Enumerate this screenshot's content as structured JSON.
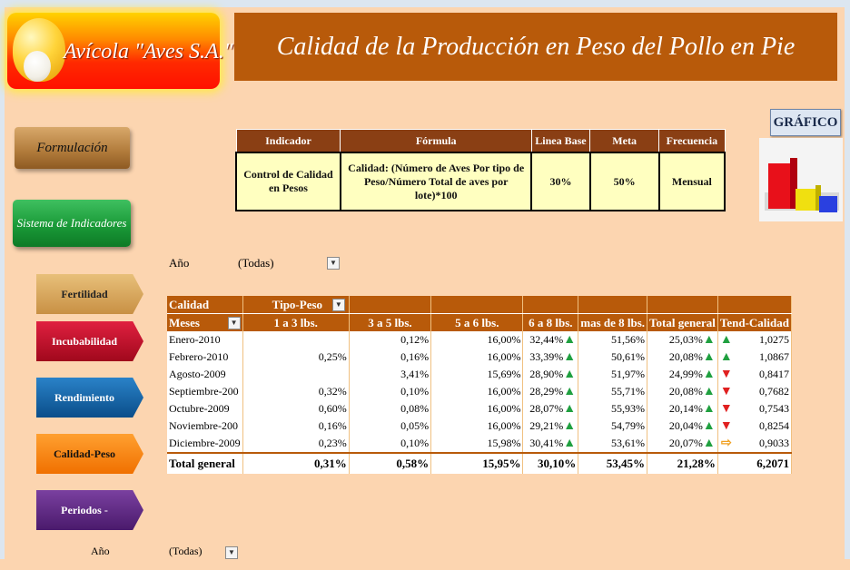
{
  "logo": {
    "text": "Avícola \"Aves S.A.\""
  },
  "header": {
    "title": "Calidad de la Producción en Peso del Pollo en Pie"
  },
  "nav": {
    "formulacion": "Formulación",
    "sistema": "Sistema de Indicadores",
    "items": [
      "Fertilidad",
      "Incubabilidad",
      "Rendimiento",
      "Calidad-Peso",
      "Periodos -Mortalidad"
    ]
  },
  "indicator_table": {
    "headers": [
      "Indicador",
      "Fórmula",
      "Linea Base",
      "Meta",
      "Frecuencia"
    ],
    "row": [
      "Control de Calidad en Pesos",
      "Calidad: (Número de Aves Por tipo de Peso/Número Total de aves por lote)*100",
      "30%",
      "50%",
      "Mensual"
    ]
  },
  "grafico_button": "GRÁFICO",
  "filter": {
    "label": "Año",
    "value": "(Todas)"
  },
  "pivot": {
    "h1": [
      "Calidad",
      "Tipo-Peso",
      "",
      "",
      "",
      "",
      "",
      ""
    ],
    "h2": [
      "Meses",
      "1 a 3 lbs.",
      "3 a 5 lbs.",
      "5 a 6 lbs.",
      "6 a 8 lbs.",
      "mas de 8 lbs.",
      "Total general",
      "Tend-Calidad"
    ],
    "rows": [
      {
        "mes": "Enero-2010",
        "v": [
          "",
          "0,12%",
          "16,00%",
          "32,44%",
          "51,56%",
          "25,03%",
          "1,0275"
        ],
        "a": [
          "up",
          "up",
          "up"
        ]
      },
      {
        "mes": "Febrero-2010",
        "v": [
          "0,25%",
          "0,16%",
          "16,00%",
          "33,39%",
          "50,61%",
          "20,08%",
          "1,0867"
        ],
        "a": [
          "up",
          "up",
          "up"
        ]
      },
      {
        "mes": "Agosto-2009",
        "v": [
          "",
          "3,41%",
          "15,69%",
          "28,90%",
          "51,97%",
          "24,99%",
          "0,8417"
        ],
        "a": [
          "up",
          "up",
          "down"
        ]
      },
      {
        "mes": "Septiembre-200",
        "v": [
          "0,32%",
          "0,10%",
          "16,00%",
          "28,29%",
          "55,71%",
          "20,08%",
          "0,7682"
        ],
        "a": [
          "up",
          "up",
          "down"
        ]
      },
      {
        "mes": "Octubre-2009",
        "v": [
          "0,60%",
          "0,08%",
          "16,00%",
          "28,07%",
          "55,93%",
          "20,14%",
          "0,7543"
        ],
        "a": [
          "up",
          "up",
          "down"
        ]
      },
      {
        "mes": "Noviembre-200",
        "v": [
          "0,16%",
          "0,05%",
          "16,00%",
          "29,21%",
          "54,79%",
          "20,04%",
          "0,8254"
        ],
        "a": [
          "up",
          "up",
          "down"
        ]
      },
      {
        "mes": "Diciembre-2009",
        "v": [
          "0,23%",
          "0,10%",
          "15,98%",
          "30,41%",
          "53,61%",
          "20,07%",
          "0,9033"
        ],
        "a": [
          "up",
          "up",
          "side"
        ]
      }
    ],
    "total": [
      "Total general",
      "0,31%",
      "0,58%",
      "15,95%",
      "30,10%",
      "53,45%",
      "21,28%",
      "6,2071"
    ]
  },
  "bottom_filter": {
    "label": "Año",
    "value": "(Todas)"
  }
}
